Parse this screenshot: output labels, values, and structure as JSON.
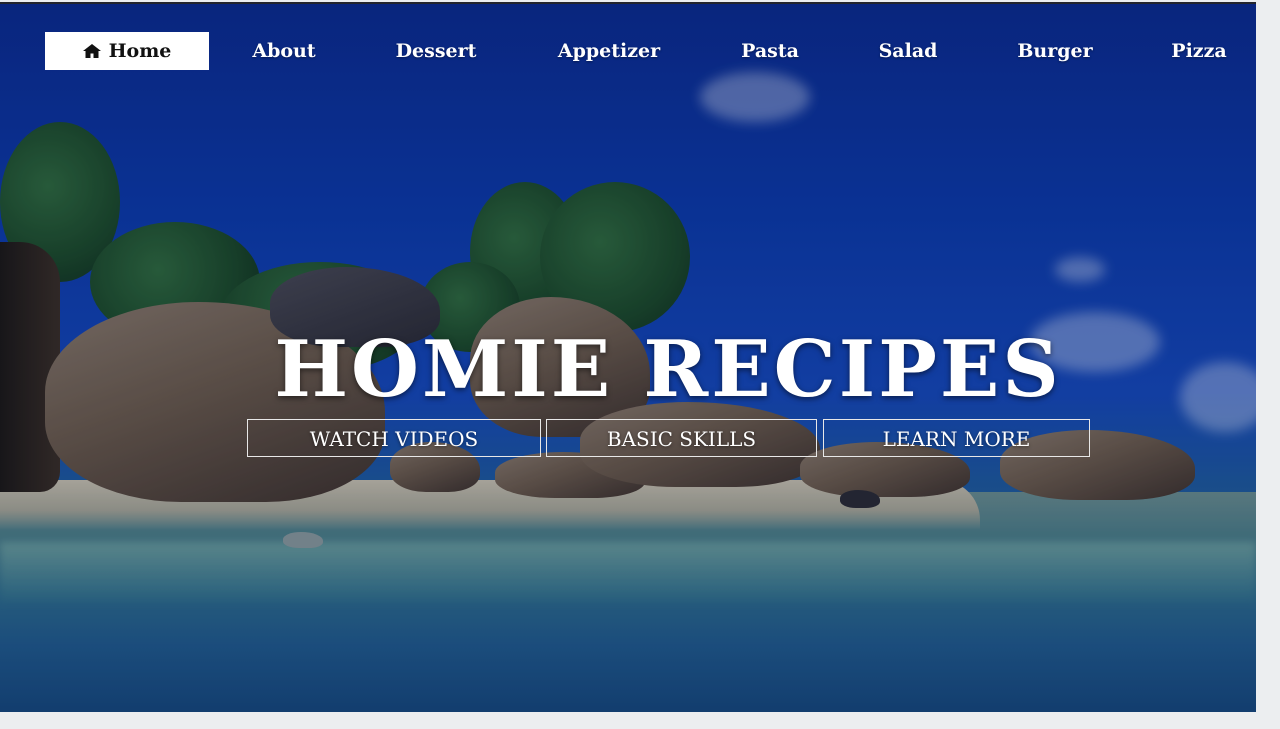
{
  "nav": {
    "items": [
      {
        "label": "Home",
        "icon": "home-icon",
        "active": true
      },
      {
        "label": "About"
      },
      {
        "label": "Dessert"
      },
      {
        "label": "Appetizer"
      },
      {
        "label": "Pasta"
      },
      {
        "label": "Salad"
      },
      {
        "label": "Burger"
      },
      {
        "label": "Pizza"
      }
    ]
  },
  "hero": {
    "title": "HOMIE RECIPES",
    "buttons": [
      {
        "label": "WATCH VIDEOS"
      },
      {
        "label": "BASIC SKILLS"
      },
      {
        "label": "LEARN MORE"
      }
    ]
  },
  "colors": {
    "nav_text": "#ffffff",
    "active_bg": "#ffffff",
    "active_text": "#111111",
    "sky": "#0c3aa8"
  }
}
